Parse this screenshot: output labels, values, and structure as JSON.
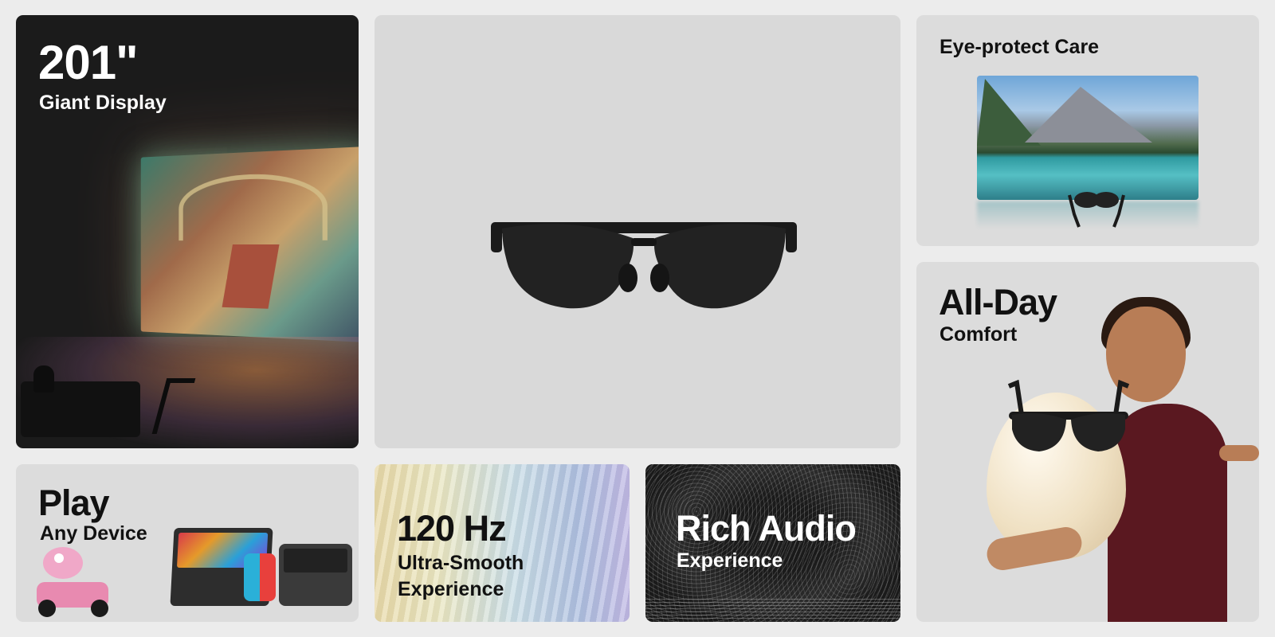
{
  "tiles": {
    "display": {
      "headline": "201\"",
      "subline": "Giant Display"
    },
    "glasses": {},
    "eye": {
      "headline": "Eye-protect Care"
    },
    "comfort": {
      "headline": "All-Day",
      "subline": "Comfort"
    },
    "play": {
      "headline": "Play",
      "subline": "Any Device"
    },
    "hz": {
      "headline": "120 Hz",
      "subline_1": "Ultra-Smooth",
      "subline_2": "Experience"
    },
    "audio": {
      "headline": "Rich Audio",
      "subline": "Experience"
    }
  },
  "icons": [
    "ar-glasses-icon"
  ]
}
